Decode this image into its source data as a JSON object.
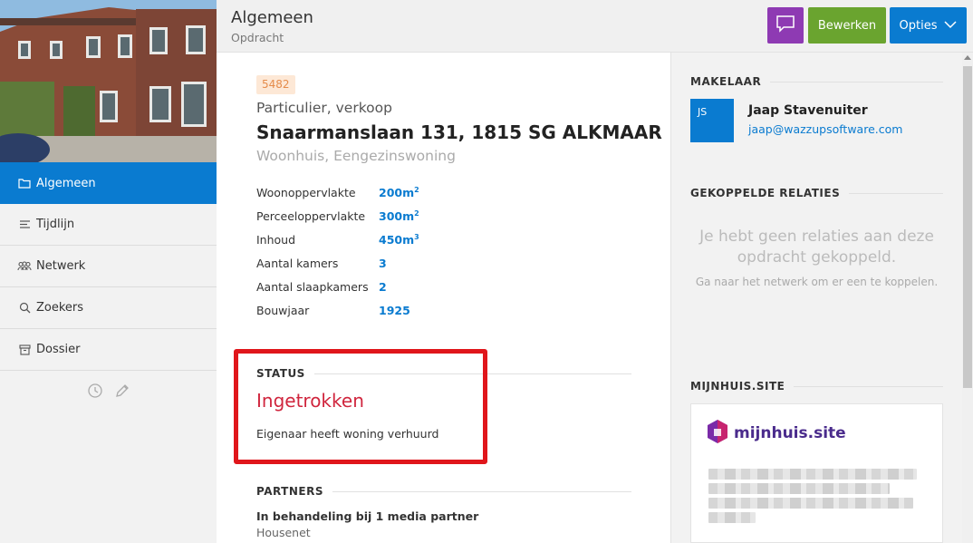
{
  "header": {
    "title": "Algemeen",
    "subtitle": "Opdracht",
    "edit_label": "Bewerken",
    "options_label": "Opties"
  },
  "sidebar": {
    "items": [
      {
        "label": "Algemeen",
        "icon": "folder-icon"
      },
      {
        "label": "Tijdlijn",
        "icon": "list-icon"
      },
      {
        "label": "Netwerk",
        "icon": "people-icon"
      },
      {
        "label": "Zoekers",
        "icon": "search-icon"
      },
      {
        "label": "Dossier",
        "icon": "archive-icon"
      }
    ],
    "tools": [
      "clock-icon",
      "pencil-icon"
    ]
  },
  "property": {
    "id": "5482",
    "type": "Particulier, verkoop",
    "address": "Snaarmanslaan 131, 1815 SG ALKMAAR",
    "subtype": "Woonhuis, Eengezinswoning",
    "specs": [
      {
        "label": "Woonoppervlakte",
        "value": "200m",
        "sup": "2"
      },
      {
        "label": "Perceeloppervlakte",
        "value": "300m",
        "sup": "2"
      },
      {
        "label": "Inhoud",
        "value": "450m",
        "sup": "3"
      },
      {
        "label": "Aantal kamers",
        "value": "3",
        "sup": ""
      },
      {
        "label": "Aantal slaapkamers",
        "value": "2",
        "sup": ""
      },
      {
        "label": "Bouwjaar",
        "value": "1925",
        "sup": ""
      }
    ]
  },
  "status": {
    "title": "STATUS",
    "value": "Ingetrokken",
    "description": "Eigenaar heeft woning verhuurd"
  },
  "partners": {
    "title": "PARTNERS",
    "line": "In behandeling bij 1 media partner",
    "sub": "Housenet"
  },
  "right": {
    "agent_title": "MAKELAAR",
    "agent_initials": "JS",
    "agent_name": "Jaap Stavenuiter",
    "agent_email": "jaap@wazzupsoftware.com",
    "relations_title": "GEKOPPELDE RELATIES",
    "relations_empty_title": "Je hebt geen relaties aan deze opdracht gekoppeld.",
    "relations_empty_sub": "Ga naar het netwerk om er een te koppelen.",
    "mijnhuis_title": "MIJNHUIS.SITE",
    "mijnhuis_logo_text": "mijnhuis.site"
  },
  "colors": {
    "accent": "#0a7bd0",
    "edit": "#6aa42f",
    "chat": "#8e3ab3",
    "status": "#d0263e",
    "highlight": "#e0161b"
  }
}
